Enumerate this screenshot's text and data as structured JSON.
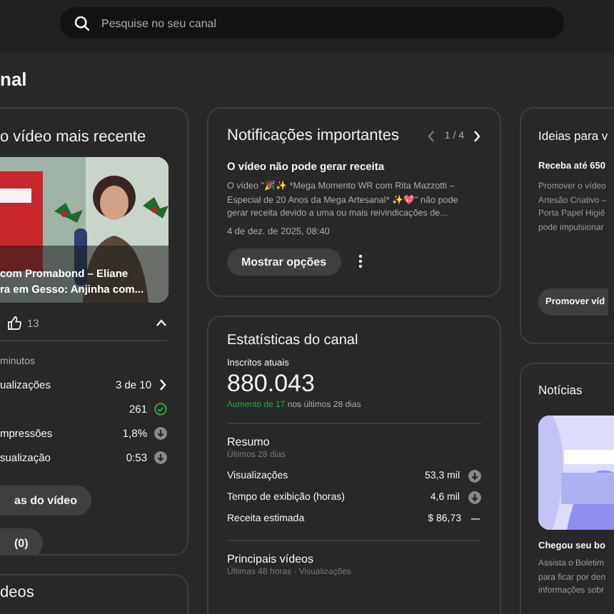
{
  "search": {
    "placeholder": "Pesquise no seu canal"
  },
  "page_title": "nal",
  "latest_video": {
    "title": "o vídeo mais recente",
    "video_title_lines": [
      "com Promabond – Eliane",
      "ra em Gesso: Anjinha com..."
    ],
    "likes": "13",
    "expanded": true,
    "period": "minutos",
    "metrics": [
      {
        "label": "ualizações",
        "value": "3 de 10",
        "kind": "link"
      },
      {
        "value": "261",
        "kind": "check"
      },
      {
        "label": "mpressões",
        "value": "1,8%",
        "kind": "down"
      },
      {
        "label": "sualização",
        "value": "0:53",
        "kind": "down"
      }
    ],
    "buttons": [
      "as do vídeo",
      "(0)"
    ]
  },
  "next_card_title": "deos",
  "notifications": {
    "title": "Notificações importantes",
    "pager": "1 / 4",
    "heading": "O vídeo não pode gerar receita",
    "body": "O vídeo \"🎉✨ *Mega Momento WR com Rita Mazzotti – Especial de 20 Anos da Mega Artesanal* ✨💖\" não pode gerar receita devido a uma ou mais reivindicações de...",
    "date": "4 de dez. de 2025, 08:40",
    "button": "Mostrar opções"
  },
  "stats": {
    "title": "Estatísticas do canal",
    "subscribers_label": "Inscritos atuais",
    "subscribers": "880.043",
    "change": "Aumento de 17",
    "change_suffix": " nos últimos 28 dias",
    "summary_title": "Resumo",
    "summary_period": "Últimos 28 dias",
    "rows": [
      {
        "label": "Visualizações",
        "value": "53,3 mil",
        "kind": "down"
      },
      {
        "label": "Tempo de exibição (horas)",
        "value": "4,6 mil",
        "kind": "down"
      },
      {
        "label": "Receita estimada",
        "value": "$ 86,73",
        "kind": "flat"
      }
    ],
    "top_title": "Principais vídeos",
    "top_period": "Últimas 48 horas · Visualizações"
  },
  "ideas": {
    "title": "Ideias para v",
    "heading": "Receba até 650",
    "lines": [
      "Promover o vídeo",
      "Artesão Criativo –",
      "Porta Papel Higiê",
      "pode impulsionar"
    ],
    "button": "Promover víd"
  },
  "news": {
    "title": "Notícias",
    "heading": "Chegou seu bo",
    "lines": [
      "Assista o Boletim",
      "para ficar por den",
      "informações sobr"
    ]
  }
}
